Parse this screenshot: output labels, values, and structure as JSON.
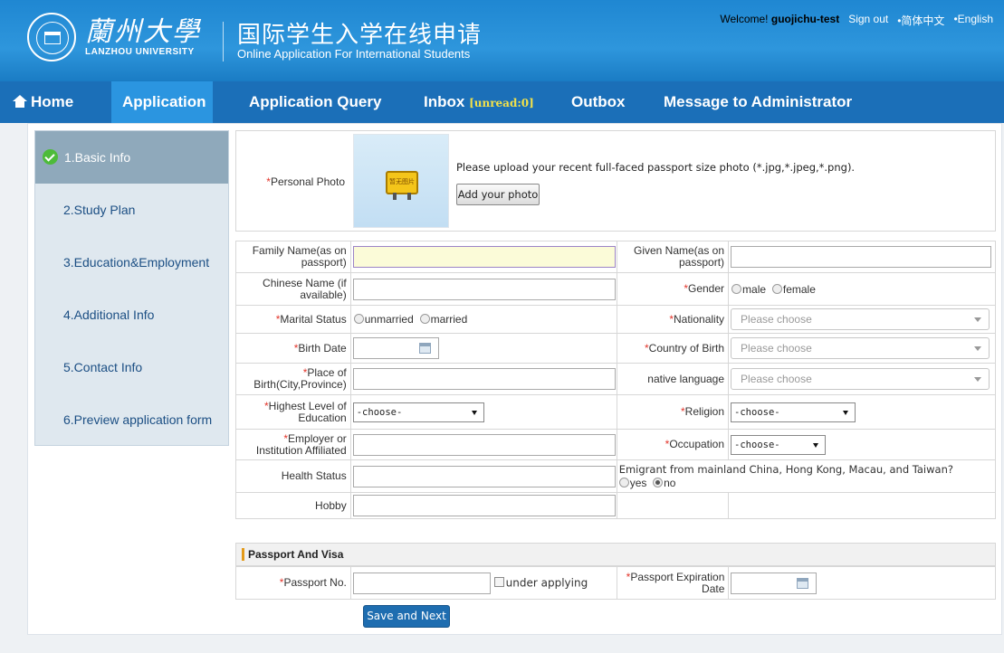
{
  "header": {
    "logo_cn": "蘭州大學",
    "logo_en": "LANZHOU UNIVERSITY",
    "title_cn": "国际学生入学在线申请",
    "title_en": "Online Application For International Students",
    "welcome": "Welcome!",
    "username": "guojichu-test",
    "sign_out": "Sign out",
    "lang_cn": "•简体中文",
    "lang_en": "•English"
  },
  "nav": {
    "home": "Home",
    "application": "Application",
    "query": "Application Query",
    "inbox": "Inbox",
    "inbox_unread": "[unread:0]",
    "outbox": "Outbox",
    "message": "Message to Administrator"
  },
  "sidebar": {
    "items": [
      {
        "label": "1.Basic Info"
      },
      {
        "label": "2.Study Plan"
      },
      {
        "label": "3.Education&Employment"
      },
      {
        "label": "4.Additional Info"
      },
      {
        "label": "5.Contact Info"
      },
      {
        "label": "6.Preview application form"
      }
    ]
  },
  "photo": {
    "label": "Personal Photo",
    "placeholder_text": "暂无图片",
    "instruction": "Please upload your recent full-faced passport size photo (*.jpg,*.jpeg,*.png).",
    "button": "Add your photo"
  },
  "form": {
    "family_name": "Family Name(as on passport)",
    "given_name": "Given Name(as on passport)",
    "chinese_name": "Chinese Name (if available)",
    "gender": "Gender",
    "gender_male": "male",
    "gender_female": "female",
    "marital_status": "Marital Status",
    "marital_unmarried": "unmarried",
    "marital_married": "married",
    "nationality": "Nationality",
    "birth_date": "Birth Date",
    "country_of_birth": "Country of Birth",
    "place_of_birth": "Place of Birth(City,Province)",
    "native_language": "native language",
    "highest_education": "Highest Level of Education",
    "religion": "Religion",
    "employer": "Employer or Institution Affiliated",
    "occupation": "Occupation",
    "health_status": "Health Status",
    "emigrant_question": "Emigrant from mainland China, Hong Kong, Macau, and Taiwan?",
    "emigrant_yes": "yes",
    "emigrant_no": "no",
    "hobby": "Hobby",
    "please_choose": "Please choose",
    "choose": "-choose-"
  },
  "passport": {
    "section_title": "Passport And Visa",
    "passport_no": "Passport No.",
    "under_applying": "under applying",
    "expiration": "Passport Expiration Date"
  },
  "actions": {
    "save_next": "Save and Next"
  },
  "colors": {
    "header_blue": "#2e96dc",
    "nav_blue": "#1b6fb8",
    "required_red": "#e3352b",
    "save_button": "#1e6db0"
  }
}
